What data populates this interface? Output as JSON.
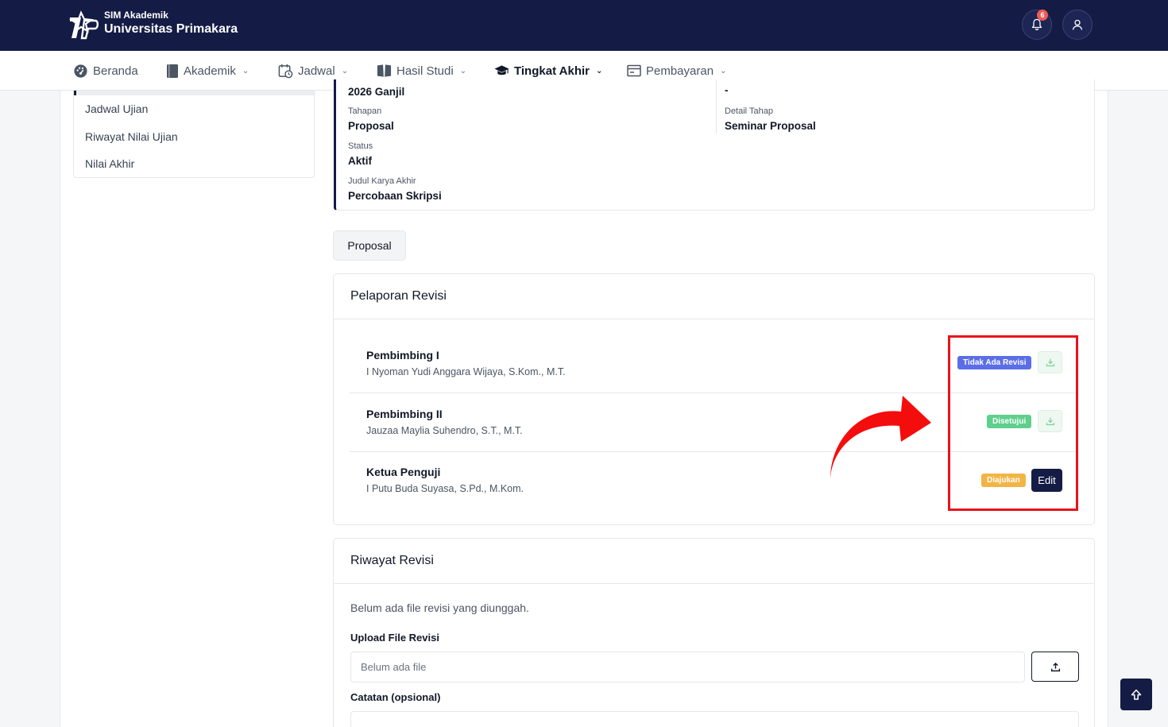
{
  "header": {
    "brand_small": "SIM Akademik",
    "brand_big": "Universitas Primakara",
    "notification_count": "6"
  },
  "nav": {
    "items": [
      {
        "label": "Beranda",
        "icon": "dashboard-icon"
      },
      {
        "label": "Akademik",
        "icon": "book-icon"
      },
      {
        "label": "Jadwal",
        "icon": "calendar-clock-icon"
      },
      {
        "label": "Hasil Studi",
        "icon": "open-book-icon"
      },
      {
        "label": "Tingkat Akhir",
        "icon": "graduation-cap-icon"
      },
      {
        "label": "Pembayaran",
        "icon": "payment-window-icon"
      }
    ]
  },
  "side_menu": {
    "items": [
      "Jadwal Ujian",
      "Riwayat Nilai Ujian",
      "Nilai Akhir"
    ]
  },
  "info": {
    "period_value": "2026 Ganjil",
    "period_right_value": "-",
    "tahapan_label": "Tahapan",
    "tahapan_value": "Proposal",
    "detail_label": "Detail Tahap",
    "detail_value": "Seminar Proposal",
    "status_label": "Status",
    "status_value": "Aktif",
    "judul_label": "Judul Karya Akhir",
    "judul_value": "Percobaan Skripsi"
  },
  "tabs": {
    "proposal": "Proposal"
  },
  "pelaporan": {
    "title": "Pelaporan Revisi",
    "rows": [
      {
        "role": "Pembimbing I",
        "name": "I Nyoman Yudi Anggara Wijaya, S.Kom., M.T.",
        "status": "Tidak Ada Revisi",
        "status_color": "#5b6ee8"
      },
      {
        "role": "Pembimbing II",
        "name": "Jauzaa Maylia Suhendro, S.T., M.T.",
        "status": "Disetujui",
        "status_color": "#5fcf8c"
      },
      {
        "role": "Ketua Penguji",
        "name": "I Putu Buda Suyasa, S.Pd., M.Kom.",
        "status": "Diajukan",
        "status_color": "#f2b544",
        "action": "Edit"
      }
    ]
  },
  "riwayat": {
    "title": "Riwayat Revisi",
    "empty_message": "Belum ada file revisi yang diunggah.",
    "upload_label": "Upload File Revisi",
    "file_placeholder": "Belum ada file",
    "note_label": "Catatan (opsional)"
  },
  "colors": {
    "primary": "#141c45",
    "highlight": "#e8121c"
  }
}
